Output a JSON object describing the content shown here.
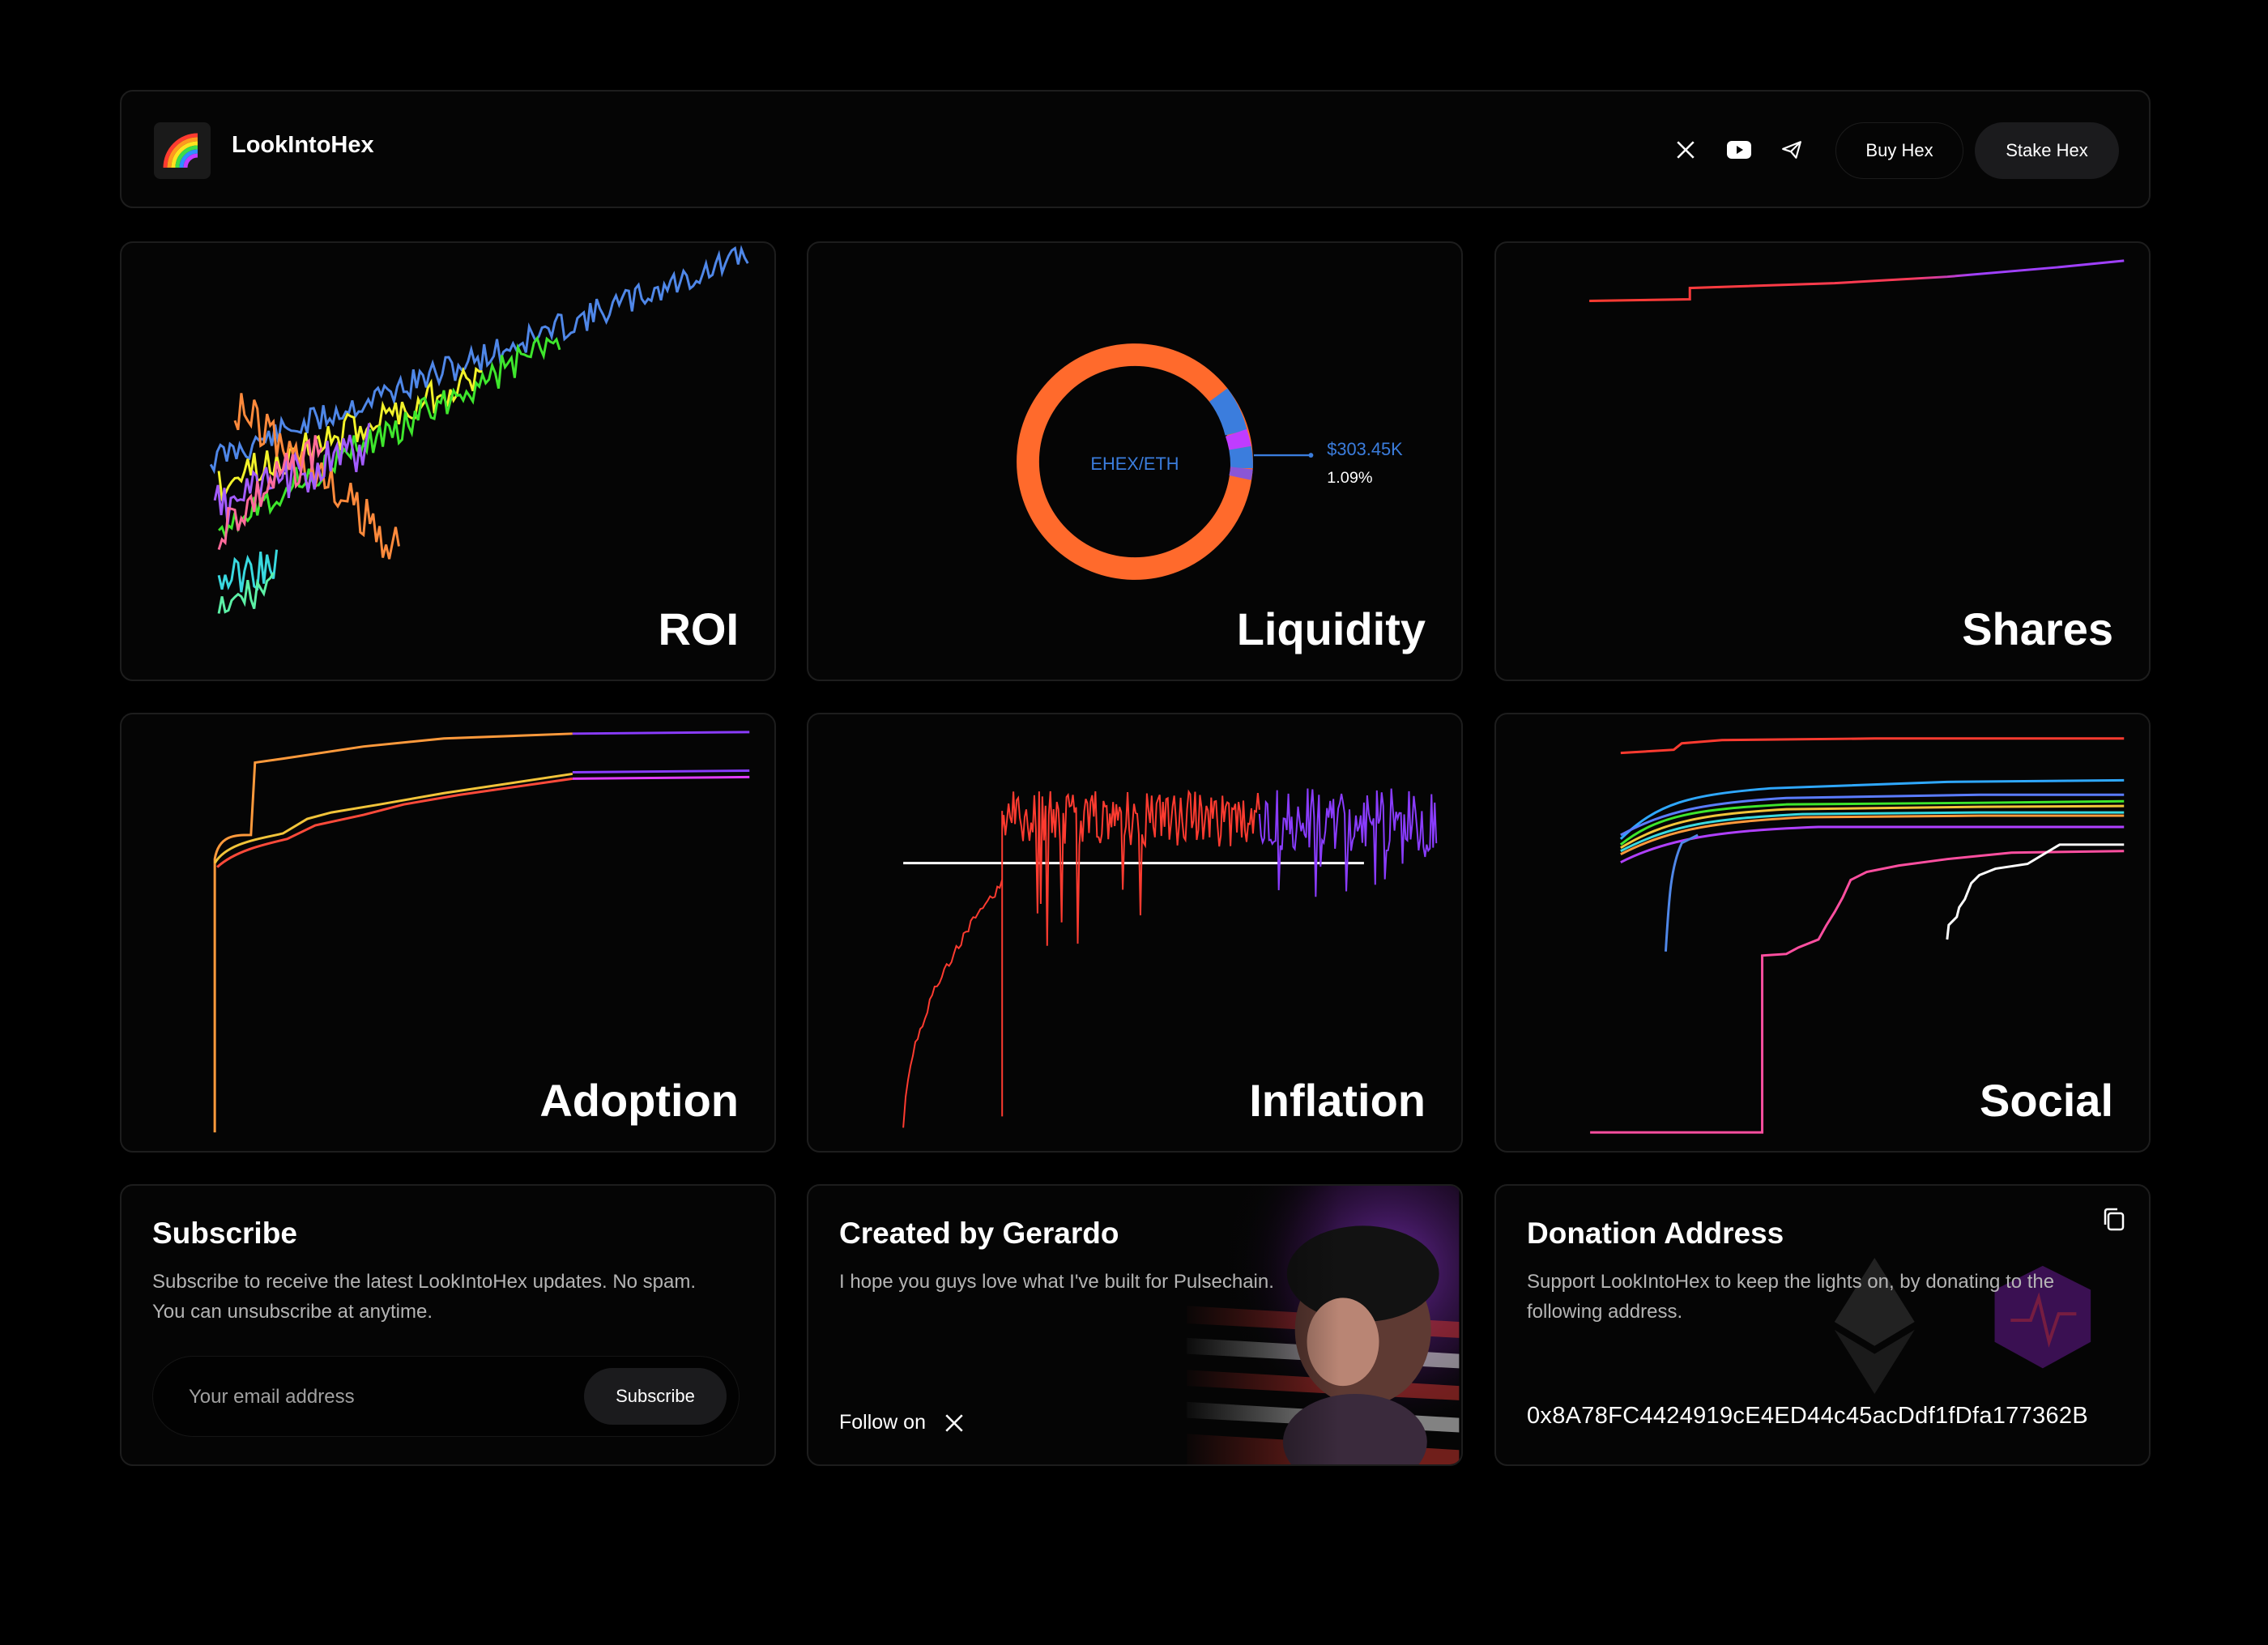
{
  "header": {
    "brand": "LookIntoHex",
    "buy_label": "Buy Hex",
    "stake_label": "Stake Hex",
    "icons": [
      "x-icon",
      "youtube-icon",
      "telegram-icon"
    ]
  },
  "cards": {
    "roi": "ROI",
    "liquidity": "Liquidity",
    "shares": "Shares",
    "adoption": "Adoption",
    "inflation": "Inflation",
    "social": "Social"
  },
  "liquidity_chart": {
    "pair_label": "EHEX/ETH",
    "callout_value": "$303.45K",
    "callout_percent": "1.09%",
    "accent": "#ff6a2c",
    "highlight": "#3b7ddd"
  },
  "subscribe": {
    "title": "Subscribe",
    "description": "Subscribe to receive the latest LookIntoHex updates. No spam. You can unsubscribe at anytime.",
    "placeholder": "Your email address",
    "button": "Subscribe"
  },
  "creator": {
    "title": "Created by Gerardo",
    "description": "I hope you guys love what I've built for Pulsechain.",
    "follow": "Follow on"
  },
  "donation": {
    "title": "Donation Address",
    "description": "Support LookIntoHex to keep the lights on, by donating to the following address.",
    "address": "0x8A78FC4424919cE4ED44c45acDdf1fDfa177362B"
  },
  "colors": {
    "background": "#000000",
    "card": "#050505",
    "orange": "#ff6a2c",
    "purple": "#8a3cff",
    "red": "#ff3b30",
    "blue": "#4f87e8"
  }
}
